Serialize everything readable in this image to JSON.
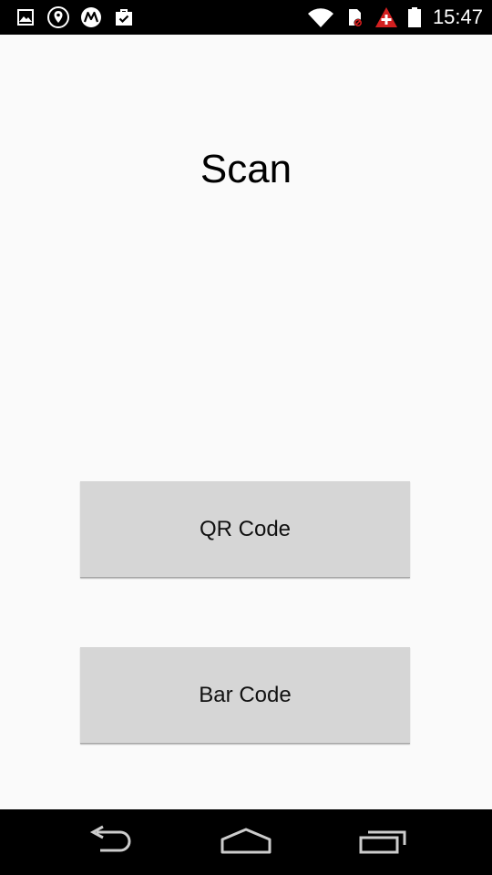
{
  "status_bar": {
    "time": "15:47",
    "left_icons": [
      "gallery-icon",
      "location-icon",
      "motorola-icon",
      "shopping-bag-icon"
    ],
    "right_icons": [
      "wifi-icon",
      "sd-card-blocked-icon",
      "swiss-alert-icon",
      "battery-icon"
    ]
  },
  "main": {
    "title": "Scan",
    "buttons": {
      "qr_label": "QR Code",
      "bar_label": "Bar Code"
    }
  },
  "nav_bar": {
    "icons": [
      "back-icon",
      "home-icon",
      "recent-apps-icon"
    ]
  },
  "colors": {
    "background": "#fafafa",
    "button_bg": "#d6d6d6",
    "status_bar_bg": "#000000",
    "alert_red": "#d32020"
  }
}
